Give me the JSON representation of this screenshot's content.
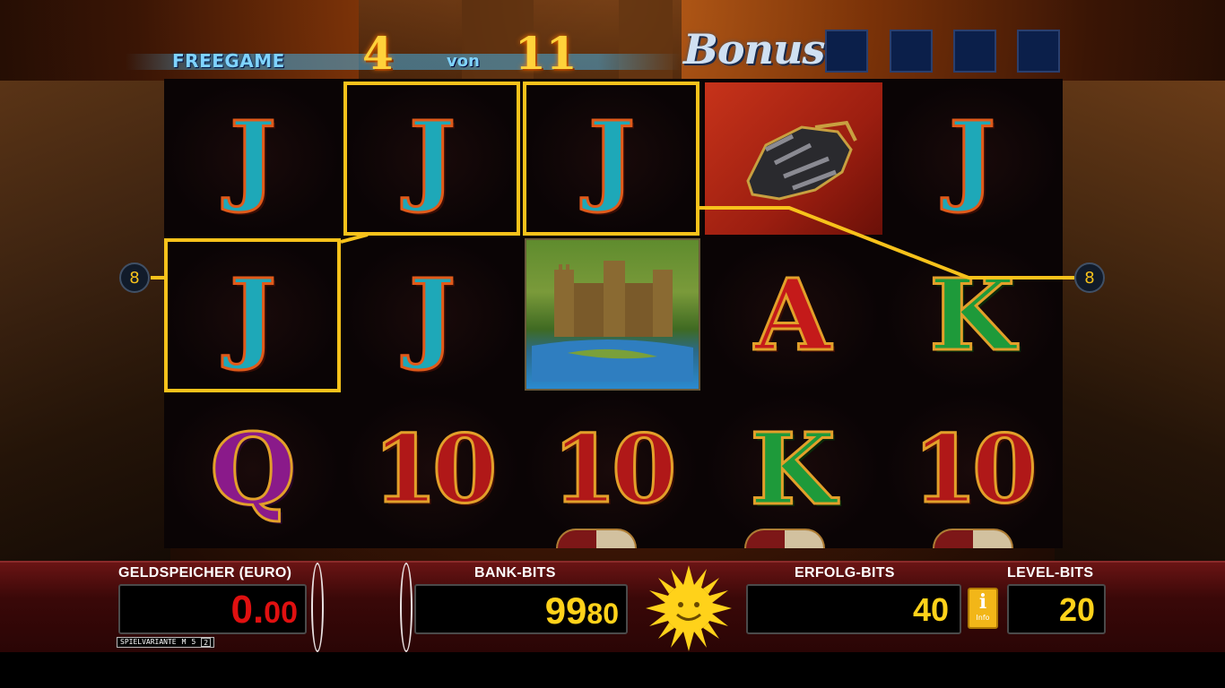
{
  "header": {
    "freegame_label": "FREEGAME",
    "freegame_current": "4",
    "von_label": "von",
    "freegame_total": "11",
    "bonus_label": "Bonus",
    "bonus_slots": 4
  },
  "reels": {
    "row1": [
      "J",
      "J",
      "J",
      "glove",
      "J"
    ],
    "row2": [
      "J",
      "J",
      "castle",
      "A",
      "K"
    ],
    "row3": [
      "Q",
      "10",
      "10",
      "K",
      "10"
    ]
  },
  "winline": {
    "line_number_left": "8",
    "line_number_right": "8"
  },
  "panel": {
    "geld_label": "GELDSPEICHER (EURO)",
    "geld_main": "0.",
    "geld_cents": "00",
    "spielvariante_label": "SPIELVARIANTE",
    "spielvariante_m": "M",
    "spielvariante_5": "5",
    "spielvariante_2": "2",
    "bank_label": "BANK-BITS",
    "bank_main": "99",
    "bank_cents": "80",
    "erfolg_label": "ERFOLG-BITS",
    "erfolg_value": "40",
    "info_letter": "i",
    "info_label": "Info",
    "level_label": "LEVEL-BITS",
    "level_value": "20"
  },
  "colors": {
    "win_frame": "#f7c21b",
    "bank_digits": "#ffd21a",
    "geld_digits": "#e01010",
    "freegame_text": "#7fd3ff"
  }
}
